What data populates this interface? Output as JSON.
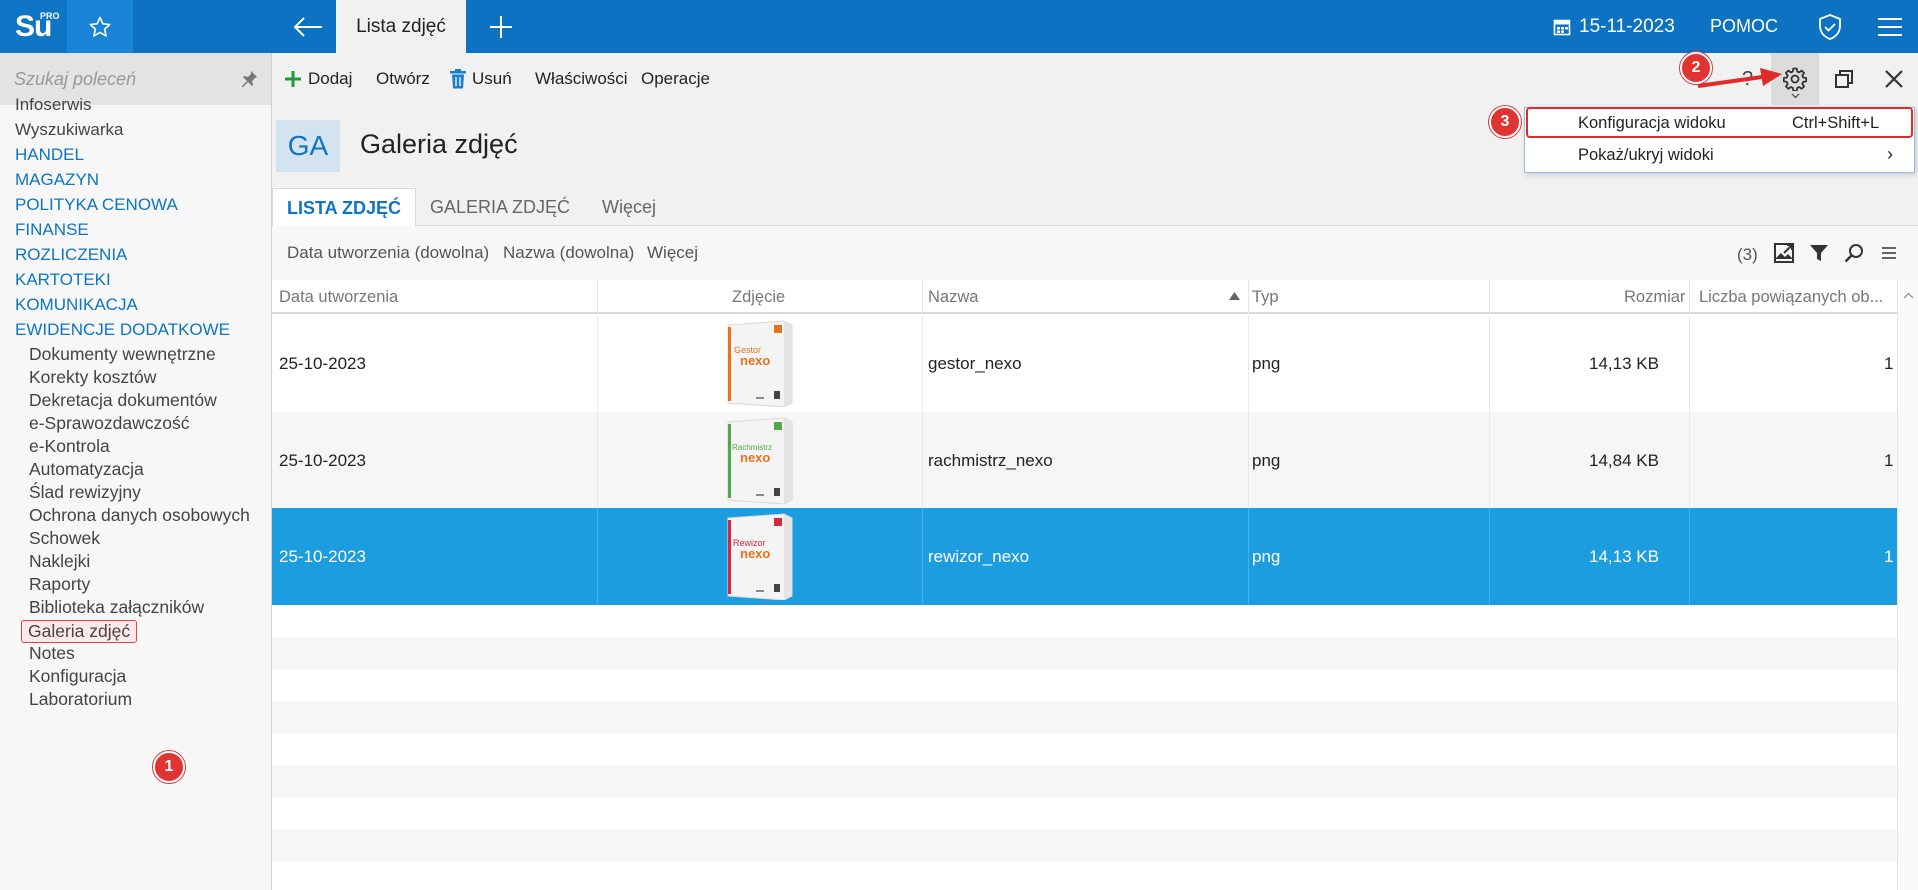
{
  "topbar": {
    "logo_text": "Su",
    "logo_sup": "PRO",
    "active_tab": "Lista zdjęć",
    "date": "15-11-2023",
    "help": "POMOC"
  },
  "sidebar": {
    "search_placeholder": "Szukaj poleceń",
    "top_items": [
      "Infoserwis",
      "Wyszukiwarka"
    ],
    "sections": [
      "HANDEL",
      "MAGAZYN",
      "POLITYKA CENOWA",
      "FINANSE",
      "ROZLICZENIA",
      "KARTOTEKI",
      "KOMUNIKACJA",
      "EWIDENCJE DODATKOWE"
    ],
    "sub_items": [
      "Dokumenty wewnętrzne",
      "Korekty kosztów",
      "Dekretacja dokumentów",
      "e-Sprawozdawczość",
      "e-Kontrola",
      "Automatyzacja",
      "Ślad rewizyjny",
      "Ochrona danych osobowych",
      "Schowek",
      "Naklejki",
      "Raporty",
      "Biblioteka załączników",
      "Galeria zdjęć",
      "Notes",
      "Konfiguracja",
      "Laboratorium"
    ],
    "selected": "Galeria zdjęć"
  },
  "toolbar": {
    "add": "Dodaj",
    "open": "Otwórz",
    "delete": "Usuń",
    "properties": "Właściwości",
    "operations": "Operacje"
  },
  "header": {
    "badge": "GA",
    "title": "Galeria zdjęć"
  },
  "tabs": [
    "LISTA ZDJĘĆ",
    "GALERIA ZDJĘĆ",
    "Więcej"
  ],
  "filters": [
    "Data utworzenia (dowolna)",
    "Nazwa (dowolna)",
    "Więcej"
  ],
  "record_count": "(3)",
  "grid": {
    "columns": [
      "Data utworzenia",
      "Zdjęcie",
      "Nazwa",
      "Typ",
      "Rozmiar",
      "Liczba powiązanych ob..."
    ],
    "rows": [
      {
        "date": "25-10-2023",
        "image": "Gestor nexo",
        "name": "gestor_nexo",
        "type": "png",
        "size": "14,13 KB",
        "count": "1"
      },
      {
        "date": "25-10-2023",
        "image": "Rachmistrz nexo",
        "name": "rachmistrz_nexo",
        "type": "png",
        "size": "14,84 KB",
        "count": "1"
      },
      {
        "date": "25-10-2023",
        "image": "Rewizor nexo",
        "name": "rewizor_nexo",
        "type": "png",
        "size": "14,13 KB",
        "count": "1"
      }
    ],
    "selected_row": 2
  },
  "context_menu": {
    "items": [
      {
        "label": "Konfiguracja widoku",
        "shortcut": "Ctrl+Shift+L"
      },
      {
        "label": "Pokaż/ukryj widoki",
        "shortcut": ""
      }
    ]
  },
  "markers": [
    "1",
    "2",
    "3"
  ],
  "colors": {
    "brand_blue": "#0d72c2",
    "selection_blue": "#1c9ddf",
    "annotation_red": "#e23333",
    "gestor": "#e8721c",
    "rachmistrz": "#55a84a",
    "rewizor": "#d9273a"
  }
}
